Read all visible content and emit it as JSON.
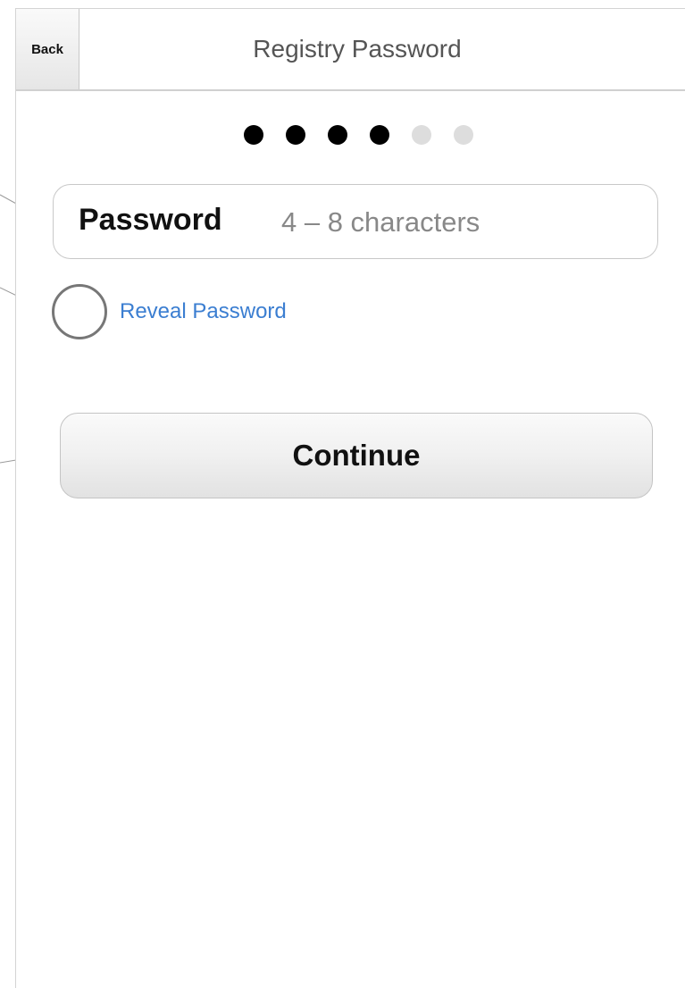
{
  "nav": {
    "back_label": "Back",
    "title": "Registry Password"
  },
  "progress": {
    "total_steps": 6,
    "current_step": 4
  },
  "password": {
    "label": "Password",
    "value": "",
    "placeholder": "4 – 8 characters"
  },
  "reveal": {
    "label": "Reveal Password",
    "checked": false
  },
  "continue_label": "Continue",
  "colors": {
    "link": "#3b7ed1",
    "dot_active": "#000000",
    "dot_inactive": "#dddddd"
  }
}
